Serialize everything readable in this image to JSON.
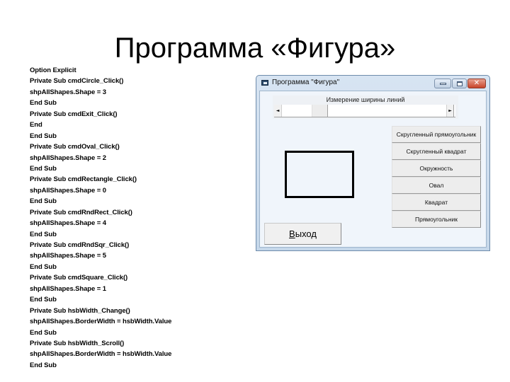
{
  "slide": {
    "title": "Программа «Фигура»",
    "code_lines": [
      "Option Explicit",
      "Private Sub cmdCircle_Click()",
      "shpAllShapes.Shape = 3",
      "End Sub",
      "Private Sub cmdExit_Click()",
      "End",
      "End Sub",
      "Private Sub cmdOval_Click()",
      "shpAllShapes.Shape = 2",
      "End Sub",
      "Private Sub cmdRectangle_Click()",
      "shpAllShapes.Shape = 0",
      "End Sub",
      "Private Sub cmdRndRect_Click()",
      "shpAllShapes.Shape = 4",
      "End Sub",
      "Private Sub cmdRndSqr_Click()",
      "shpAllShapes.Shape = 5",
      "End Sub",
      "Private Sub cmdSquare_Click()",
      "shpAllShapes.Shape = 1",
      "End Sub",
      "Private Sub hsbWidth_Change()",
      "shpAllShapes.BorderWidth = hsbWidth.Value",
      "End Sub",
      "Private Sub hsbWidth_Scroll()",
      "shpAllShapes.BorderWidth = hsbWidth.Value",
      "End Sub"
    ]
  },
  "window": {
    "title": "Программа \"Фигура\"",
    "icon": "form-icon",
    "controls": {
      "minimize": "minimize-icon",
      "maximize": "maximize-icon",
      "close": "close-icon",
      "close_glyph": "✕"
    },
    "frame_label": "Измерение ширины линий",
    "scrollbar": {
      "left_arrow": "◄",
      "right_arrow": "►",
      "value_fraction": 0.2
    },
    "shape": {
      "type": "rectangle"
    },
    "exit_button": {
      "mnemonic": "В",
      "rest": "ыход"
    },
    "shape_buttons": [
      "Скругленный прямоугольник",
      "Скругленный квадрат",
      "Окружность",
      "Овал",
      "Квадрат",
      "Прямоугольник"
    ]
  }
}
